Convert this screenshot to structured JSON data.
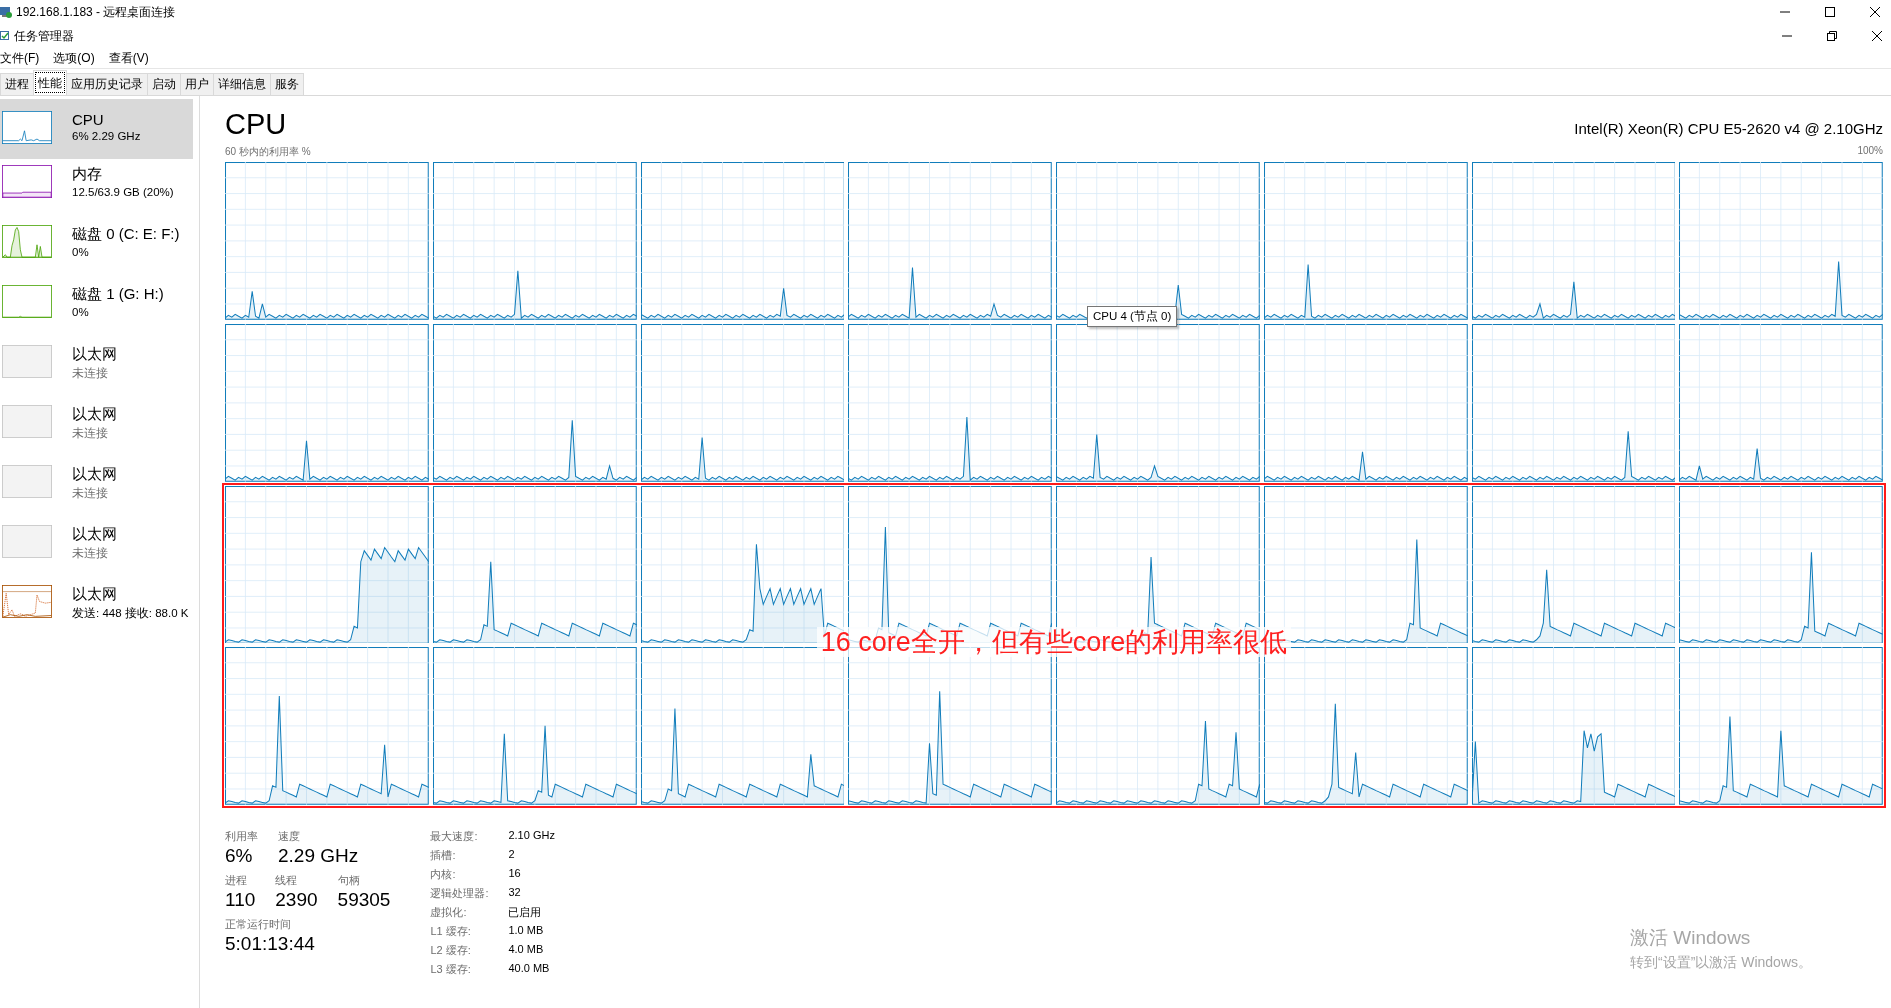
{
  "remote_window": {
    "title": "192.168.1.183 - 远程桌面连接"
  },
  "window": {
    "title": "任务管理器"
  },
  "menu": [
    "文件(F)",
    "选项(O)",
    "查看(V)"
  ],
  "tabs": [
    {
      "label": "进程",
      "selected": false
    },
    {
      "label": "性能",
      "selected": true
    },
    {
      "label": "应用历史记录",
      "selected": false
    },
    {
      "label": "启动",
      "selected": false
    },
    {
      "label": "用户",
      "selected": false
    },
    {
      "label": "详细信息",
      "selected": false
    },
    {
      "label": "服务",
      "selected": false
    }
  ],
  "sidebar": {
    "items": [
      {
        "kind": "cpu",
        "title": "CPU",
        "subtitle": "6% 2.29 GHz",
        "selected": true
      },
      {
        "kind": "memory",
        "title": "内存",
        "subtitle": "12.5/63.9 GB (20%)",
        "selected": false
      },
      {
        "kind": "disk",
        "title": "磁盘 0 (C: E: F:)",
        "subtitle": "0%",
        "selected": false
      },
      {
        "kind": "disk-idle",
        "title": "磁盘 1 (G: H:)",
        "subtitle": "0%",
        "selected": false
      },
      {
        "kind": "ethernet-off",
        "title": "以太网",
        "subtitle": "未连接",
        "selected": false
      },
      {
        "kind": "ethernet-off",
        "title": "以太网",
        "subtitle": "未连接",
        "selected": false
      },
      {
        "kind": "ethernet-off",
        "title": "以太网",
        "subtitle": "未连接",
        "selected": false
      },
      {
        "kind": "ethernet-off",
        "title": "以太网",
        "subtitle": "未连接",
        "selected": false
      },
      {
        "kind": "ethernet",
        "title": "以太网",
        "subtitle": "发送: 448 接收: 88.0 K",
        "selected": false
      }
    ]
  },
  "panel": {
    "title": "CPU",
    "model": "Intel(R) Xeon(R) CPU E5-2620 v4 @ 2.10GHz",
    "graph_caption": "60 秒内的利用率 %",
    "graph_max": "100%",
    "tooltip": "CPU 4 (节点 0)",
    "annotation": "16 core全开，但有些core的利用率很低"
  },
  "stats": {
    "rows": [
      [
        {
          "label": "利用率",
          "value": "6%"
        },
        {
          "label": "速度",
          "value": "2.29 GHz"
        }
      ],
      [
        {
          "label": "进程",
          "value": "110"
        },
        {
          "label": "线程",
          "value": "2390"
        },
        {
          "label": "句柄",
          "value": "59305"
        }
      ],
      [
        {
          "label": "正常运行时间",
          "value": "5:01:13:44"
        }
      ]
    ],
    "details": [
      {
        "label": "最大速度:",
        "value": "2.10 GHz"
      },
      {
        "label": "插槽:",
        "value": "2"
      },
      {
        "label": "内核:",
        "value": "16"
      },
      {
        "label": "逻辑处理器:",
        "value": "32"
      },
      {
        "label": "虚拟化:",
        "value": "已启用"
      },
      {
        "label": "L1 缓存:",
        "value": "1.0 MB"
      },
      {
        "label": "L2 缓存:",
        "value": "4.0 MB"
      },
      {
        "label": "L3 缓存:",
        "value": "40.0 MB"
      }
    ]
  },
  "activation": {
    "title": "激活 Windows",
    "text": "转到“设置”以激活 Windows。"
  }
}
